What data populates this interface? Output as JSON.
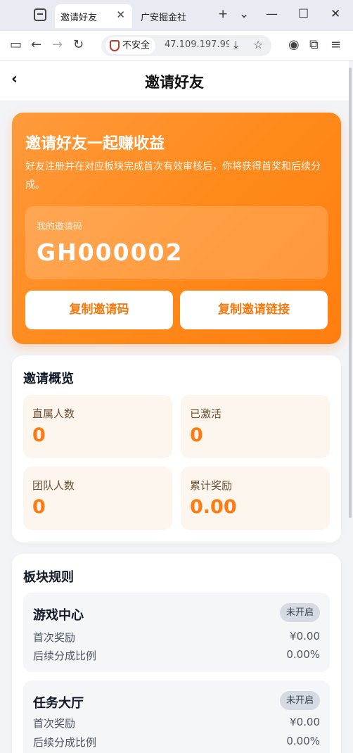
{
  "browser": {
    "active_tab_title": "邀请好友",
    "second_tab_title": "广安掘金社",
    "security_label": "不安全",
    "url": "47.109.197.99"
  },
  "header": {
    "title": "邀请好友",
    "back_glyph": "‹"
  },
  "hero": {
    "title": "邀请好友一起赚收益",
    "description": "好友注册并在对应板块完成首次有效审核后，你将获得首奖和后续分成。",
    "code_label": "我的邀请码",
    "code_value": "GH000002",
    "copy_code_label": "复制邀请码",
    "copy_link_label": "复制邀请链接",
    "accent_color": "#ff8a1c"
  },
  "overview": {
    "title": "邀请概览",
    "stats": [
      {
        "label": "直属人数",
        "value": "0"
      },
      {
        "label": "已激活",
        "value": "0"
      },
      {
        "label": "团队人数",
        "value": "0"
      },
      {
        "label": "累计奖励",
        "value": "0.00"
      }
    ]
  },
  "rules": {
    "title": "板块规则",
    "items": [
      {
        "name": "游戏中心",
        "status": "未开启",
        "first_label": "首次奖励",
        "first_value": "¥0.00",
        "share_label": "后续分成比例",
        "share_value": "0.00%"
      },
      {
        "name": "任务大厅",
        "status": "未开启",
        "first_label": "首次奖励",
        "first_value": "¥0.00",
        "share_label": "后续分成比例",
        "share_value": "0.00%"
      }
    ]
  }
}
